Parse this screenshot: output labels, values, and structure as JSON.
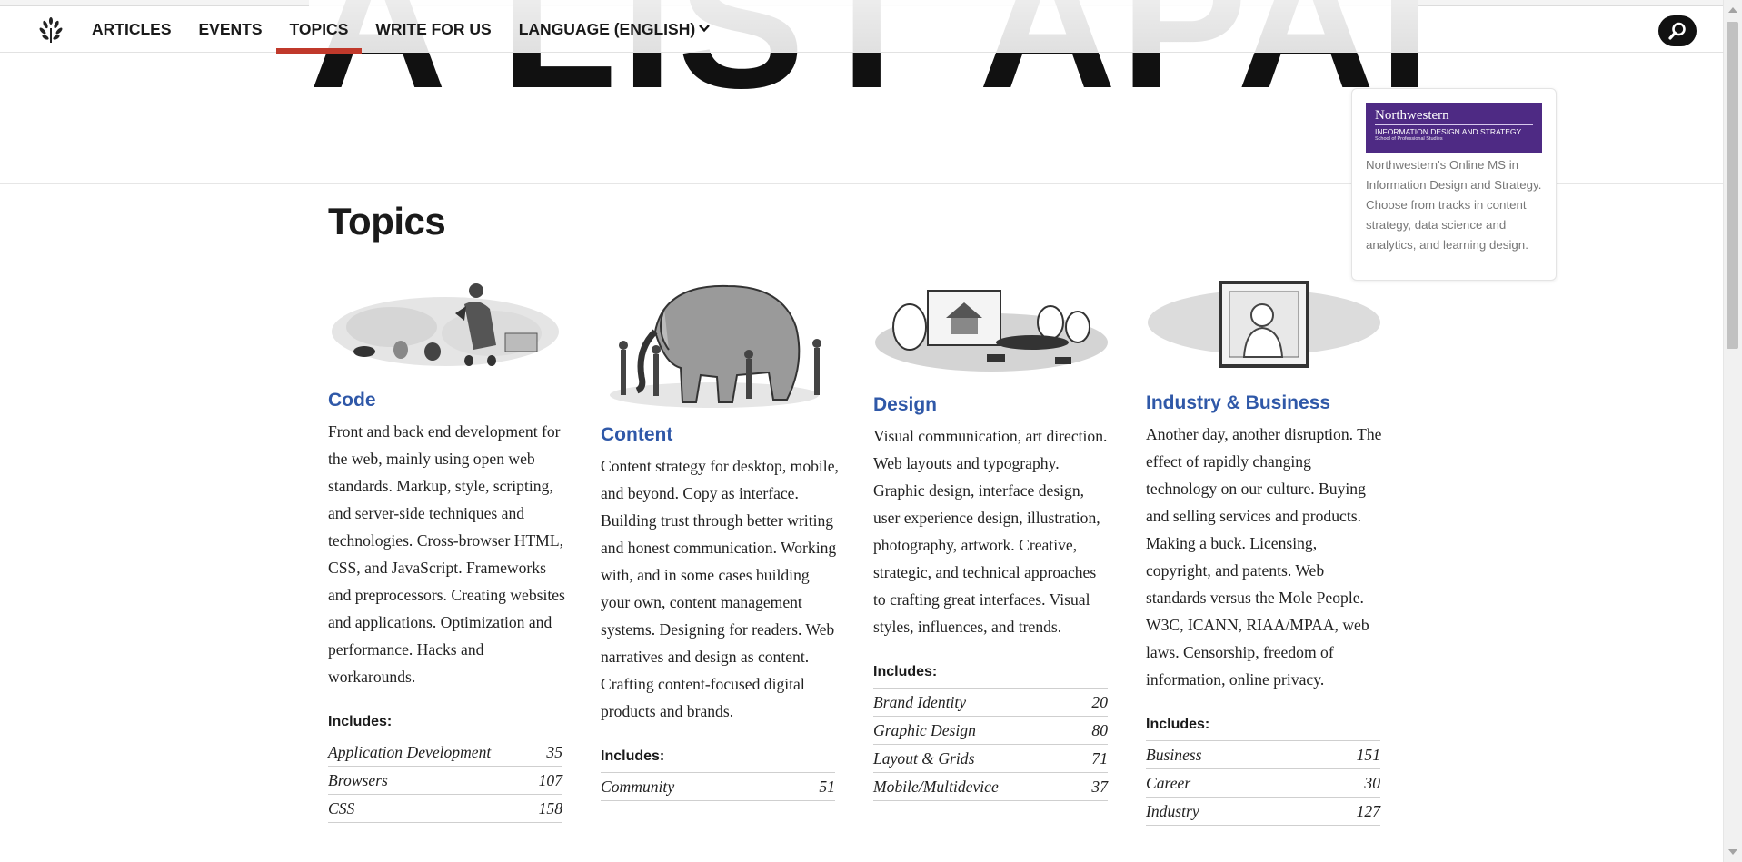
{
  "nav": {
    "items": [
      {
        "label": "ARTICLES"
      },
      {
        "label": "EVENTS"
      },
      {
        "label": "TOPICS"
      },
      {
        "label": "WRITE FOR US"
      },
      {
        "label": "LANGUAGE (ENGLISH)"
      }
    ],
    "active_item": "TOPICS",
    "logo_icon": "laurel-logo-icon",
    "search_icon": "search-icon"
  },
  "masthead": {
    "title": "A LIST APART"
  },
  "ad": {
    "brand": "Northwestern",
    "program": "INFORMATION DESIGN AND STRATEGY",
    "school": "School of Professional Studies",
    "copy": "Northwestern's Online MS in Information Design and Strategy. Choose from tracks in content strategy, data science and analytics, and learning design.",
    "banner_color": "#4e2a84"
  },
  "page": {
    "title": "Topics"
  },
  "colors": {
    "link": "#2f58a8",
    "accent": "#c0392b",
    "text": "#222222"
  },
  "topics": [
    {
      "name": "Code",
      "description": "Front and back end development for the web, mainly using open web standards. Markup, style, scripting, and server-side techniques and technologies. Cross-browser HTML, CSS, and JavaScript. Frameworks and preprocessors. Creating websites and applications. Optimization and performance. Hacks and workarounds.",
      "includes_label": "Includes:",
      "subtopics": [
        {
          "name": "Application Development",
          "count": "35"
        },
        {
          "name": "Browsers",
          "count": "107"
        },
        {
          "name": "CSS",
          "count": "158"
        }
      ]
    },
    {
      "name": "Content",
      "description": "Content strategy for desktop, mobile, and beyond. Copy as interface. Building trust through better writing and honest communication. Working with, and in some cases building your own, content management systems. Designing for readers. Web narratives and design as content. Crafting content-focused digital products and brands.",
      "includes_label": "Includes:",
      "subtopics": [
        {
          "name": "Community",
          "count": "51"
        }
      ]
    },
    {
      "name": "Design",
      "description": "Visual communication, art direction. Web layouts and typography. Graphic design, interface design, user experience design, illustration, photography, artwork. Creative, strategic, and technical approaches to crafting great interfaces. Visual styles, influences, and trends.",
      "includes_label": "Includes:",
      "subtopics": [
        {
          "name": "Brand Identity",
          "count": "20"
        },
        {
          "name": "Graphic Design",
          "count": "80"
        },
        {
          "name": "Layout & Grids",
          "count": "71"
        },
        {
          "name": "Mobile/Multidevice",
          "count": "37"
        }
      ]
    },
    {
      "name": "Industry & Business",
      "description": "Another day, another disruption. The effect of rapidly changing technology on our culture. Buying and selling services and products. Making a buck. Licensing, copyright, and patents. Web standards versus the Mole People. W3C, ICANN, RIAA/MPAA, web laws. Censorship, freedom of information, online privacy.",
      "includes_label": "Includes:",
      "subtopics": [
        {
          "name": "Business",
          "count": "151"
        },
        {
          "name": "Career",
          "count": "30"
        },
        {
          "name": "Industry",
          "count": "127"
        }
      ]
    }
  ]
}
